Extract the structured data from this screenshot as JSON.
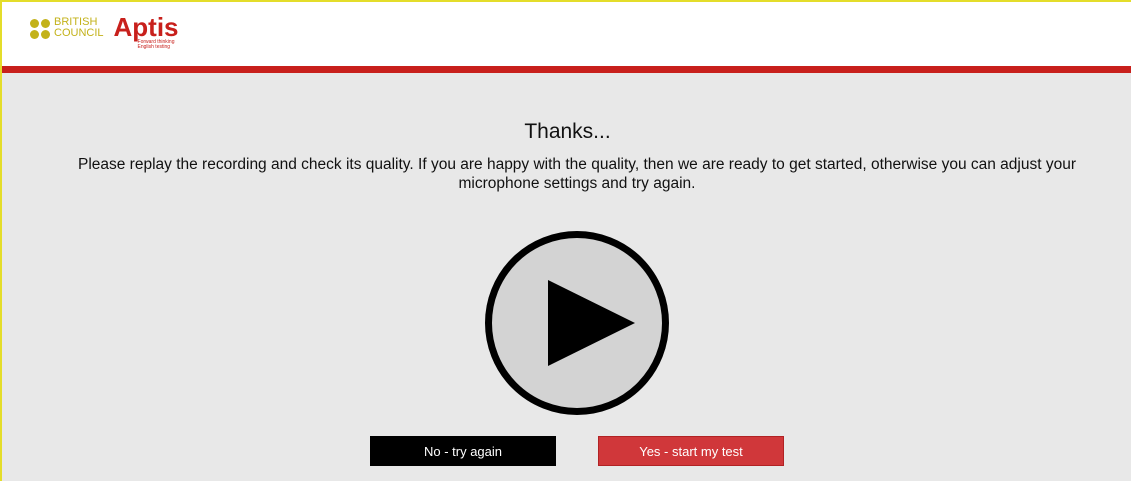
{
  "header": {
    "org_line1": "BRITISH",
    "org_line2": "COUNCIL",
    "product_name": "Aptis",
    "product_tagline": "Forward thinking English testing",
    "brand_color": "#c8201c",
    "org_color": "#c3b21a"
  },
  "main": {
    "title": "Thanks...",
    "message": "Please replay the recording and check its quality. If you are happy with the quality, then we are ready to get started, otherwise you can adjust your microphone settings and try again.",
    "play_icon": "play-icon"
  },
  "actions": {
    "no_label": "No - try again",
    "yes_label": "Yes - start my test",
    "yes_color": "#d0373a",
    "no_color": "#000000"
  }
}
